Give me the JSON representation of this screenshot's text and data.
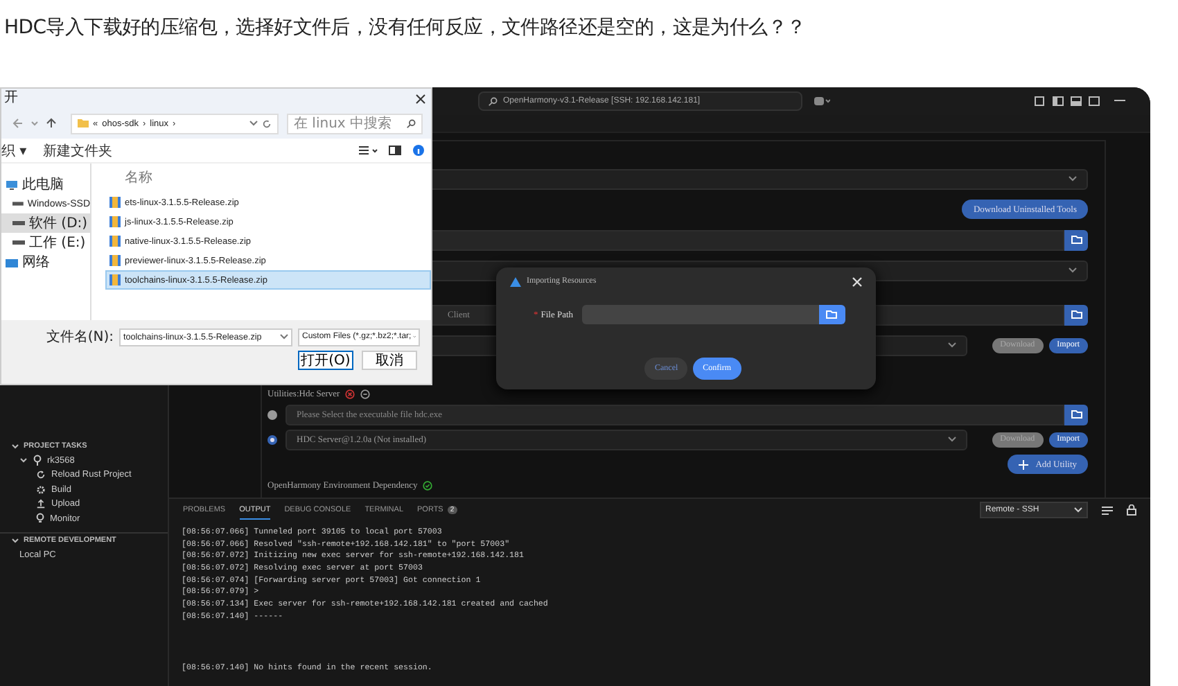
{
  "question": "HDC导入下载好的压缩包，选择好文件后，没有任何反应，文件路径还是空的，这是为什么？？",
  "ide": {
    "title_search": "OpenHarmony-v3.1-Release [SSH: 192.168.142.181]",
    "settings": [
      {
        "kind": "select"
      },
      {
        "kind": "action",
        "label": "Download Uninstalled Tools"
      },
      {
        "kind": "path"
      },
      {
        "kind": "select"
      },
      {
        "kind": "path",
        "placeholder": "Client"
      },
      {
        "kind": "select",
        "buttons": [
          {
            "label": "Download",
            "disabled": true
          },
          {
            "label": "Import",
            "disabled": false
          }
        ]
      },
      {
        "kind": "heading",
        "label": "Utilities:Hdc Server"
      },
      {
        "kind": "radio_path",
        "selected": false,
        "placeholder": "Please Select the executable file hdc.exe"
      },
      {
        "kind": "radio_select",
        "selected": true,
        "value": "HDC Server@1.2.0a (Not installed)",
        "buttons": [
          {
            "label": "Download",
            "disabled": true
          },
          {
            "label": "Import",
            "disabled": false
          }
        ]
      },
      {
        "kind": "add",
        "label": "Add Utility"
      },
      {
        "kind": "heading",
        "label": "OpenHarmony Environment Dependency"
      }
    ],
    "sidebar": [
      {
        "label": "PROJECT TASKS",
        "expanded": true,
        "children": [
          {
            "label": "rk3568",
            "expanded": true,
            "children": [
              {
                "label": "Reload Rust Project"
              },
              {
                "label": "Build"
              },
              {
                "label": "Upload"
              },
              {
                "label": "Monitor"
              }
            ]
          }
        ]
      },
      {
        "label": "REMOTE DEVELOPMENT",
        "expanded": true,
        "children": [
          {
            "label": "Local PC"
          }
        ]
      }
    ],
    "panel": {
      "tabs": [
        {
          "label": "PROBLEMS",
          "selected": false
        },
        {
          "label": "OUTPUT",
          "selected": true
        },
        {
          "label": "DEBUG CONSOLE",
          "selected": false
        },
        {
          "label": "TERMINAL",
          "selected": false
        },
        {
          "label": "PORTS",
          "selected": false,
          "badge": "2"
        }
      ],
      "channel": "Remote - SSH",
      "log_blocks": [
        [
          "[08:56:07.066] Tunneled port 39105 to local port 57003",
          "[08:56:07.066] Resolved \"ssh-remote+192.168.142.181\" to \"port 57003\"",
          "[08:56:07.072] Initizing new exec server for ssh-remote+192.168.142.181",
          "[08:56:07.072] Resolving exec server at port 57003",
          "[08:56:07.074] [Forwarding server port 57003] Got connection 1",
          "[08:56:07.079] >",
          "[08:56:07.134] Exec server for ssh-remote+192.168.142.181 created and cached",
          "[08:56:07.140] ------"
        ],
        [
          "[08:56:07.140] No hints found in the recent session."
        ]
      ]
    }
  },
  "modal": {
    "title": "Importing Resources",
    "field_label": "File Path",
    "required_mark": "*",
    "buttons": [
      {
        "label": "Cancel",
        "kind": "secondary"
      },
      {
        "label": "Confirm",
        "kind": "primary"
      }
    ]
  },
  "dialog": {
    "title": "开",
    "breadcrumb": [
      "«",
      "ohos-sdk",
      "›",
      "linux",
      "›"
    ],
    "search_placeholder": "在 linux 中搜索",
    "toolbar": [
      "织 ▾",
      "新建文件夹"
    ],
    "nav": [
      {
        "label": "此电脑",
        "selected": false
      },
      {
        "label": "Windows-SSD",
        "selected": false
      },
      {
        "label": "软件 (D:)",
        "selected": true
      },
      {
        "label": "工作 (E:)",
        "selected": false
      },
      {
        "label": "网络",
        "selected": false
      }
    ],
    "column": "名称",
    "files": [
      {
        "name": "ets-linux-3.1.5.5-Release.zip",
        "selected": false
      },
      {
        "name": "js-linux-3.1.5.5-Release.zip",
        "selected": false
      },
      {
        "name": "native-linux-3.1.5.5-Release.zip",
        "selected": false
      },
      {
        "name": "previewer-linux-3.1.5.5-Release.zip",
        "selected": false
      },
      {
        "name": "toolchains-linux-3.1.5.5-Release.zip",
        "selected": true
      }
    ],
    "filename_label": "文件名(N):",
    "filename": "toolchains-linux-3.1.5.5-Release.zip",
    "filter": "Custom Files (*.gz;*.bz2;*.tar;",
    "buttons": [
      {
        "label": "打开(O)",
        "kind": "primary"
      },
      {
        "label": "取消",
        "kind": "secondary"
      }
    ]
  }
}
